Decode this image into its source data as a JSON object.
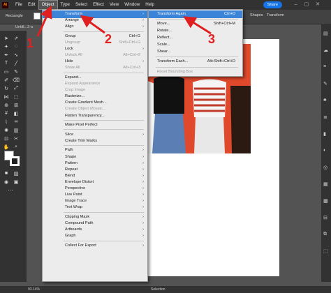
{
  "menubar": {
    "logo": "Ai",
    "items": [
      "File",
      "Edit",
      "Object",
      "Type",
      "Select",
      "Effect",
      "View",
      "Window",
      "Help"
    ],
    "share_label": "Share"
  },
  "controlbar": {
    "label": "Rectangle",
    "shapes_label": "Shapes",
    "transform_label": "Transform"
  },
  "document_tab": "Untitl...2-a",
  "object_menu": [
    {
      "label": "Transform",
      "shortcut": "",
      "submenu": true,
      "state": "selected"
    },
    {
      "label": "Arrange",
      "shortcut": "",
      "submenu": true,
      "state": "normal"
    },
    {
      "label": "Align",
      "shortcut": "",
      "submenu": true,
      "state": "normal"
    },
    {
      "sep": true
    },
    {
      "label": "Group",
      "shortcut": "Ctrl+G",
      "submenu": false,
      "state": "normal"
    },
    {
      "label": "Ungroup",
      "shortcut": "Shift+Ctrl+G",
      "submenu": false,
      "state": "disabled"
    },
    {
      "label": "Lock",
      "shortcut": "",
      "submenu": true,
      "state": "normal"
    },
    {
      "label": "Unlock All",
      "shortcut": "Alt+Ctrl+2",
      "submenu": false,
      "state": "disabled"
    },
    {
      "label": "Hide",
      "shortcut": "",
      "submenu": true,
      "state": "normal"
    },
    {
      "label": "Show All",
      "shortcut": "Alt+Ctrl+3",
      "submenu": false,
      "state": "disabled"
    },
    {
      "sep": true
    },
    {
      "label": "Expand...",
      "shortcut": "",
      "submenu": false,
      "state": "normal"
    },
    {
      "label": "Expand Appearance",
      "shortcut": "",
      "submenu": false,
      "state": "disabled"
    },
    {
      "label": "Crop Image",
      "shortcut": "",
      "submenu": false,
      "state": "disabled"
    },
    {
      "label": "Rasterize...",
      "shortcut": "",
      "submenu": false,
      "state": "normal"
    },
    {
      "label": "Create Gradient Mesh...",
      "shortcut": "",
      "submenu": false,
      "state": "normal"
    },
    {
      "label": "Create Object Mosaic...",
      "shortcut": "",
      "submenu": false,
      "state": "disabled"
    },
    {
      "label": "Flatten Transparency...",
      "shortcut": "",
      "submenu": false,
      "state": "normal"
    },
    {
      "sep": true
    },
    {
      "label": "Make Pixel Perfect",
      "shortcut": "",
      "submenu": false,
      "state": "normal"
    },
    {
      "sep": true
    },
    {
      "label": "Slice",
      "shortcut": "",
      "submenu": true,
      "state": "normal"
    },
    {
      "label": "Create Trim Marks",
      "shortcut": "",
      "submenu": false,
      "state": "normal"
    },
    {
      "sep": true
    },
    {
      "label": "Path",
      "shortcut": "",
      "submenu": true,
      "state": "normal"
    },
    {
      "label": "Shape",
      "shortcut": "",
      "submenu": true,
      "state": "normal"
    },
    {
      "label": "Pattern",
      "shortcut": "",
      "submenu": true,
      "state": "normal"
    },
    {
      "label": "Repeat",
      "shortcut": "",
      "submenu": true,
      "state": "normal"
    },
    {
      "label": "Blend",
      "shortcut": "",
      "submenu": true,
      "state": "normal"
    },
    {
      "label": "Envelope Distort",
      "shortcut": "",
      "submenu": true,
      "state": "normal"
    },
    {
      "label": "Perspective",
      "shortcut": "",
      "submenu": true,
      "state": "normal"
    },
    {
      "label": "Live Paint",
      "shortcut": "",
      "submenu": true,
      "state": "normal"
    },
    {
      "label": "Image Trace",
      "shortcut": "",
      "submenu": true,
      "state": "normal"
    },
    {
      "label": "Text Wrap",
      "shortcut": "",
      "submenu": true,
      "state": "normal"
    },
    {
      "sep": true
    },
    {
      "label": "Clipping Mask",
      "shortcut": "",
      "submenu": true,
      "state": "normal"
    },
    {
      "label": "Compound Path",
      "shortcut": "",
      "submenu": true,
      "state": "normal"
    },
    {
      "label": "Artboards",
      "shortcut": "",
      "submenu": true,
      "state": "normal"
    },
    {
      "label": "Graph",
      "shortcut": "",
      "submenu": true,
      "state": "normal"
    },
    {
      "sep": true
    },
    {
      "label": "Collect For Export",
      "shortcut": "",
      "submenu": true,
      "state": "normal"
    }
  ],
  "transform_submenu": [
    {
      "label": "Transform Again",
      "shortcut": "Ctrl+D",
      "state": "selected"
    },
    {
      "sep": true
    },
    {
      "label": "Move...",
      "shortcut": "Shift+Ctrl+M",
      "state": "normal"
    },
    {
      "label": "Rotate...",
      "shortcut": "",
      "state": "normal"
    },
    {
      "label": "Reflect...",
      "shortcut": "",
      "state": "normal"
    },
    {
      "label": "Scale...",
      "shortcut": "",
      "state": "normal"
    },
    {
      "label": "Shear...",
      "shortcut": "",
      "state": "normal"
    },
    {
      "sep": true
    },
    {
      "label": "Transform Each...",
      "shortcut": "Alt+Shift+Ctrl+D",
      "state": "normal"
    },
    {
      "sep": true
    },
    {
      "label": "Reset Bounding Box",
      "shortcut": "",
      "state": "disabled"
    }
  ],
  "annotations": [
    "1",
    "2",
    "3"
  ],
  "statusbar": {
    "zoom": "93.14%",
    "mode": "Selection"
  },
  "colors": {
    "accent": "#3b84d8",
    "annotation": "#e02020",
    "photo_bg": "#e0492c"
  }
}
